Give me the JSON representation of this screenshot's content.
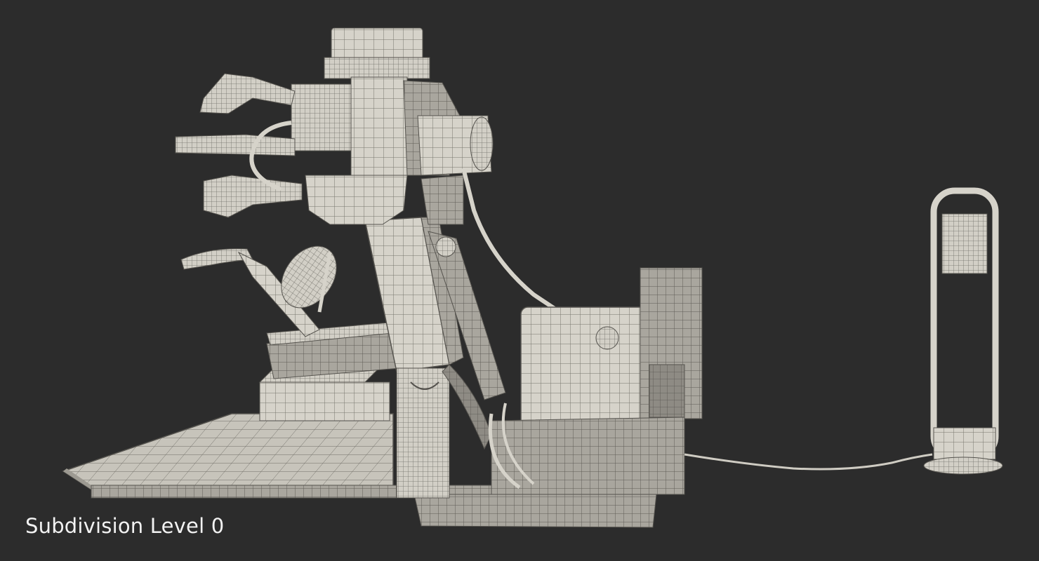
{
  "caption": {
    "text": "Subdivision Level 0"
  },
  "render": {
    "subject": "tire-changer-machine-wireframe",
    "background_color": "#2c2c2c",
    "mesh_fill_color": "#d8d5cc",
    "wire_color": "#6a6860"
  }
}
